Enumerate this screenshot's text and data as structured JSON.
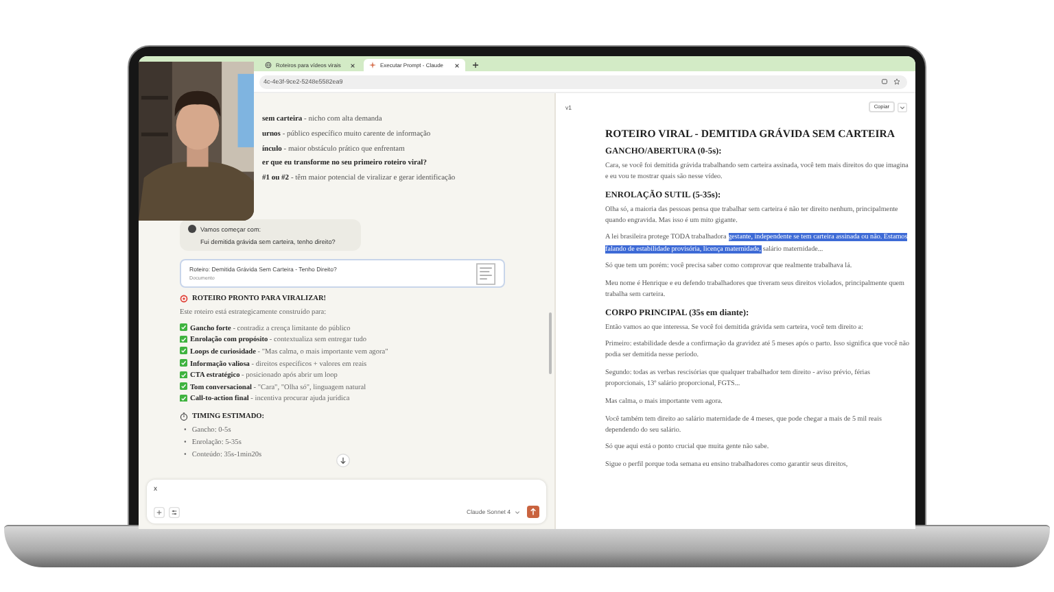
{
  "browser": {
    "tabs": [
      {
        "label": "Roteiros para vídeos virais",
        "selected": false
      },
      {
        "label": "Executar Prompt - Claude",
        "selected": true
      }
    ],
    "address": "4c-4e3f-9ce2-5248e5582ea9"
  },
  "chat": {
    "earlier_lines": [
      {
        "text": "**sem carteira** - nicho com alta demanda",
        "bold": false
      },
      {
        "text": "**urnos** - público específico muito carente de informação",
        "bold": false
      },
      {
        "text": "**ínculo** - maior obstáculo prático que enfrentam",
        "bold": false
      },
      {
        "text": "er que eu transforme no seu primeiro roteiro viral?",
        "bold": true
      },
      {
        "text": "**#1 ou #2** - têm maior potencial de viralizar e gerar identificação",
        "bold": false
      }
    ],
    "user_message": {
      "intro": "Vamos começar com:",
      "text": "Fui demitida grávida sem carteira, tenho direito?"
    },
    "artifact_card": {
      "title": "Roteiro: Demitida Grávida Sem Carteira - Tenho Direito?",
      "type": "Documento"
    },
    "reply_heading": "ROTEIRO PRONTO PARA VIRALIZAR!",
    "reply_intro": "Este roteiro está estrategicamente construído para:",
    "features": [
      "**Gancho forte** - contradiz a crença limitante do público",
      "**Enrolação com propósito** - contextualiza sem entregar tudo",
      "**Loops de curiosidade** - \"Mas calma, o mais importante vem agora\"",
      "**Informação valiosa** - direitos específicos + valores em reais",
      "**CTA estratégico** - posicionado após abrir um loop",
      "**Tom conversacional** - \"Cara\", \"Olha só\", linguagem natural",
      "**Call-to-action final** - incentiva procurar ajuda jurídica"
    ],
    "timing_heading": "TIMING ESTIMADO:",
    "timing": [
      {
        "bullet": "•",
        "text": "Gancho: 0-5s"
      },
      {
        "bullet": "•",
        "text": "Enrolação: 5-35s"
      },
      {
        "bullet": "•",
        "text": "Conteúdo: 35s-1min20s"
      }
    ]
  },
  "composer": {
    "value": "x",
    "model": "Claude Sonnet 4"
  },
  "artifact": {
    "version": "v1",
    "copy_button": "Copiar",
    "blocks": [
      {
        "kind": "title",
        "text": "ROTEIRO VIRAL - DEMITIDA GRÁVIDA SEM CARTEIRA"
      },
      {
        "kind": "heading",
        "text": "GANCHO/ABERTURA (0-5s):"
      },
      {
        "kind": "paragraph",
        "text": "Cara, se você foi demitida grávida trabalhando sem carteira assinada, você tem mais direitos do que imagina e eu vou te mostrar quais são nesse vídeo."
      },
      {
        "kind": "heading",
        "text": "ENROLAÇÃO SUTIL (5-35s):"
      },
      {
        "kind": "paragraph",
        "text": "Olha só, a maioria das pessoas pensa que trabalhar sem carteira é não ter direito nenhum, principalmente quando engravida. Mas isso é um mito gigante."
      },
      {
        "kind": "paragraph",
        "segments": [
          {
            "text": "A lei brasileira protege TODA trabalhadora ",
            "highlighted": false
          },
          {
            "text": "gestante, independente se tem carteira assinada ou não. Estamos falando de estabilidade provisória, licença maternidade,",
            "highlighted": true
          },
          {
            "text": " salário maternidade...",
            "highlighted": false
          }
        ]
      },
      {
        "kind": "paragraph",
        "text": "Só que tem um porém: você precisa saber como comprovar que realmente trabalhava lá."
      },
      {
        "kind": "paragraph",
        "text": "Meu nome é Henrique e eu defendo trabalhadores que tiveram seus direitos violados, principalmente quem trabalha sem carteira."
      },
      {
        "kind": "heading",
        "text": "CORPO PRINCIPAL (35s em diante):"
      },
      {
        "kind": "paragraph",
        "text": "Então vamos ao que interessa. Se você foi demitida grávida sem carteira, você tem direito a:"
      },
      {
        "kind": "paragraph",
        "text": "Primeiro: estabilidade desde a confirmação da gravidez até 5 meses após o parto. Isso significa que você não podia ser demitida nesse período."
      },
      {
        "kind": "paragraph",
        "text": "Segundo: todas as verbas rescisórias que qualquer trabalhador tem direito - aviso prévio, férias proporcionais, 13º salário proporcional, FGTS..."
      },
      {
        "kind": "paragraph",
        "text": "Mas calma, o mais importante vem agora."
      },
      {
        "kind": "paragraph",
        "text": "Você também tem direito ao salário maternidade de 4 meses, que pode chegar a mais de 5 mil reais dependendo do seu salário."
      },
      {
        "kind": "paragraph",
        "text": "Só que aqui está o ponto crucial que muita gente não sabe."
      },
      {
        "kind": "paragraph",
        "text": "Sigue o perfil porque toda semana eu ensino trabalhadores como garantir seus direitos,"
      }
    ]
  }
}
